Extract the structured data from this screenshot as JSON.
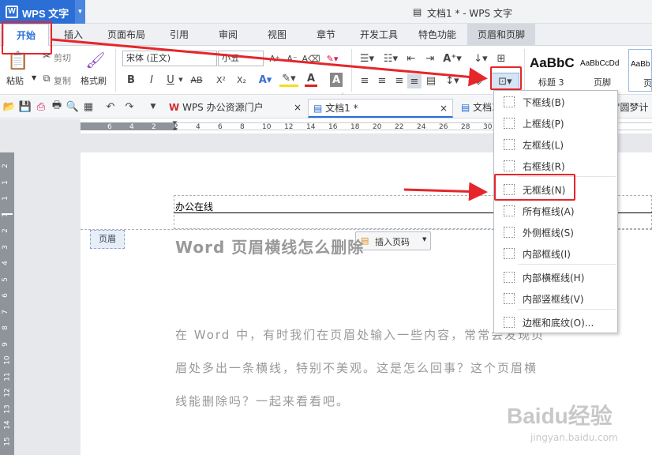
{
  "app": {
    "name": "WPS 文字",
    "logo": "W",
    "title": "文档1 * - WPS 文字"
  },
  "ribbon_tabs": [
    "开始",
    "插入",
    "页面布局",
    "引用",
    "审阅",
    "视图",
    "章节",
    "开发工具",
    "特色功能",
    "页眉和页脚"
  ],
  "clipboard": {
    "paste": "粘贴",
    "cut": "剪切",
    "copy": "复制",
    "format_painter": "格式刷"
  },
  "font": {
    "family": "宋体 (正文)",
    "size": "小五"
  },
  "format_buttons": {
    "bold": "B",
    "italic": "I",
    "underline": "U",
    "strike": "AB",
    "superscript": "X²",
    "subscript": "X₂",
    "font_color": "A",
    "char_shade": "A"
  },
  "styles": [
    {
      "preview": "AaBbC",
      "name": "标题 3"
    },
    {
      "preview": "AaBbCcDd",
      "name": "页脚"
    },
    {
      "preview": "AaBb",
      "name": "页"
    }
  ],
  "doc_tabs": [
    "WPS 办公资源门户",
    "文档1 *",
    "文档3",
    "\"圆梦计"
  ],
  "ruler_ticks": [
    "6",
    "4",
    "2",
    "2",
    "4",
    "6",
    "8",
    "10",
    "12",
    "14",
    "16",
    "18",
    "20",
    "22",
    "24",
    "26",
    "28",
    "30"
  ],
  "vruler_ticks": [
    "2",
    "1",
    "1",
    "1",
    "2",
    "3",
    "4",
    "5",
    "6",
    "7",
    "8",
    "9",
    "10",
    "11",
    "12",
    "13",
    "14",
    "15"
  ],
  "document": {
    "header_text": "办公在线",
    "header_tag": "页眉",
    "insert_page_number": "插入页码",
    "heading": "Word 页眉横线怎么删除",
    "body_lines": [
      "在 Word 中，有时我们在页眉处输入一些内容，常常会发现页",
      "眉处多出一条横线，特别不美观。这是怎么回事？这个页眉横",
      "线能删除吗？一起来看看吧。"
    ]
  },
  "border_menu": [
    {
      "label": "下框线(B)",
      "icon": "border-bottom-icon"
    },
    {
      "label": "上框线(P)",
      "icon": "border-top-icon"
    },
    {
      "label": "左框线(L)",
      "icon": "border-left-icon"
    },
    {
      "label": "右框线(R)",
      "icon": "border-right-icon"
    },
    {
      "label": "无框线(N)",
      "icon": "border-none-icon"
    },
    {
      "label": "所有框线(A)",
      "icon": "border-all-icon"
    },
    {
      "label": "外侧框线(S)",
      "icon": "border-outside-icon"
    },
    {
      "label": "内部框线(I)",
      "icon": "border-inside-icon"
    },
    {
      "label": "内部横框线(H)",
      "icon": "border-inside-horizontal-icon"
    },
    {
      "label": "内部竖框线(V)",
      "icon": "border-inside-vertical-icon"
    },
    {
      "label": "边框和底纹(O)...",
      "icon": "borders-shading-icon"
    }
  ],
  "watermark": {
    "brand": "Baidu经验",
    "url": "jingyan.baidu.com"
  },
  "colors": {
    "accent": "#2b6fd6",
    "highlight": "#e5262b",
    "doc_text": "#999999"
  }
}
